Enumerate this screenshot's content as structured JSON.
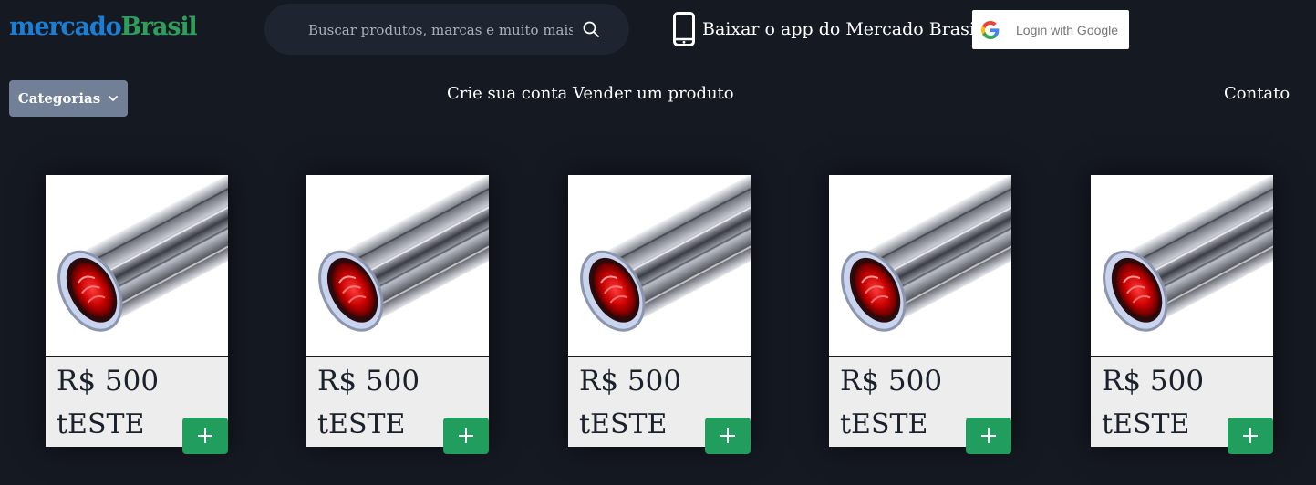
{
  "header": {
    "logo_part1": "mercado",
    "logo_part2": "Brasil",
    "search_placeholder": "Buscar produtos, marcas e muito mais...",
    "app_label": "Baixar o app do Mercado Brasil",
    "google_label": "Login with Google",
    "icons": {
      "search": "search-icon",
      "phone": "phone-icon",
      "google": "google-icon",
      "chevron": "chevron-down-icon",
      "plus": "plus-icon"
    }
  },
  "nav": {
    "categories_label": "Categorias",
    "create_account": "Crie sua conta",
    "sell_product": "Vender um produto",
    "contact": "Contato"
  },
  "colors": {
    "background": "#151922",
    "logo_blue": "#1a7fd4",
    "logo_green": "#2e9e5b",
    "add_button": "#219d5e",
    "categories_button": "#718096"
  },
  "products": [
    {
      "price": "R$ 500",
      "name": "tESTE"
    },
    {
      "price": "R$ 500",
      "name": "tESTE"
    },
    {
      "price": "R$ 500",
      "name": "tESTE"
    },
    {
      "price": "R$ 500",
      "name": "tESTE"
    },
    {
      "price": "R$ 500",
      "name": "tESTE"
    }
  ]
}
